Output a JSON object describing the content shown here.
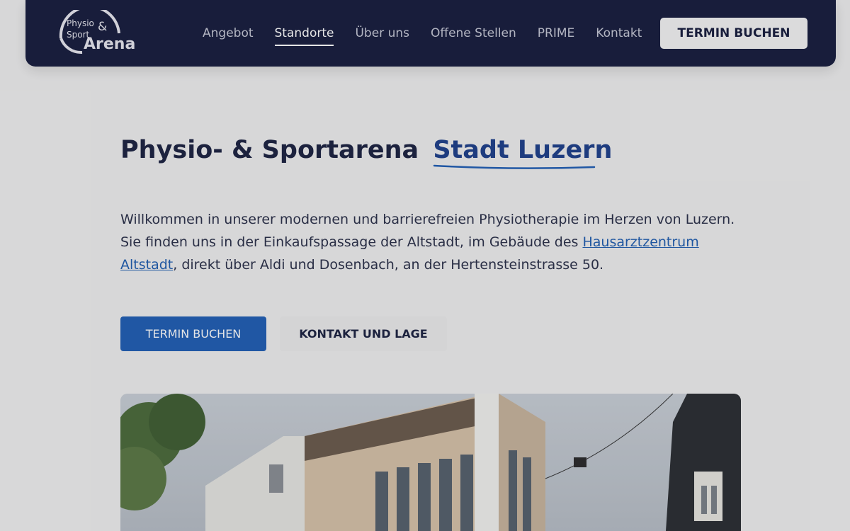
{
  "logo": {
    "line1": "Physio",
    "line2": "Sport",
    "amp": "&",
    "line3": "Arena"
  },
  "nav": {
    "items": [
      {
        "label": "Angebot"
      },
      {
        "label": "Standorte"
      },
      {
        "label": "Über uns"
      },
      {
        "label": "Offene Stellen"
      },
      {
        "label": "PRIME"
      },
      {
        "label": "Kontakt"
      }
    ],
    "active": "Standorte",
    "cta_label": "TERMIN BUCHEN"
  },
  "hero": {
    "title_prefix": "Physio- & Sportarena",
    "title_highlight": "Stadt Luzern",
    "intro_before_link": "Willkommen in unserer modernen und barrierefreien Physiotherapie im Herzen von Luzern. Sie finden uns in der Einkaufspassage der Altstadt, im Gebäude des ",
    "intro_link": "Hausarztzentrum Altstadt",
    "intro_after_link": ", direkt über Aldi und Dosenbach, an der Hertensteinstrasse 50."
  },
  "buttons": {
    "primary": "TERMIN BUCHEN",
    "secondary": "KONTAKT UND LAGE"
  },
  "colors": {
    "navbar": "#161c3d",
    "accent": "#1f5eb4",
    "title": "#1b2140"
  },
  "image": {
    "semantic": "building-photo"
  }
}
